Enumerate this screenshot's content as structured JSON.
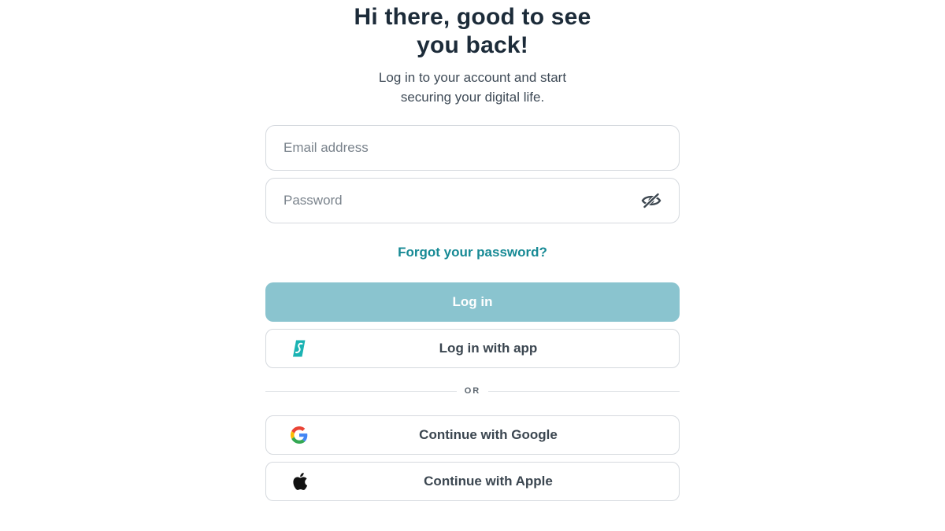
{
  "header": {
    "title_line1": "Hi there, good to see",
    "title_line2": "you back!",
    "subtitle_line1": "Log in to your account and start",
    "subtitle_line2": "securing your digital life."
  },
  "form": {
    "email_placeholder": "Email address",
    "email_value": "",
    "password_placeholder": "Password",
    "password_value": "",
    "password_toggle_icon": "eye-slash-icon",
    "forgot_link": "Forgot your password?"
  },
  "buttons": {
    "login": "Log in",
    "login_with_app": "Log in with app",
    "login_with_app_icon": "surfshark-logo-icon",
    "divider": "OR",
    "google": "Continue with Google",
    "google_icon": "google-icon",
    "apple": "Continue with Apple",
    "apple_icon": "apple-icon"
  },
  "colors": {
    "primary_button": "#8ac4cf",
    "link": "#178a95",
    "heading": "#1c2b39",
    "brand_teal": "#1bb3b3"
  }
}
